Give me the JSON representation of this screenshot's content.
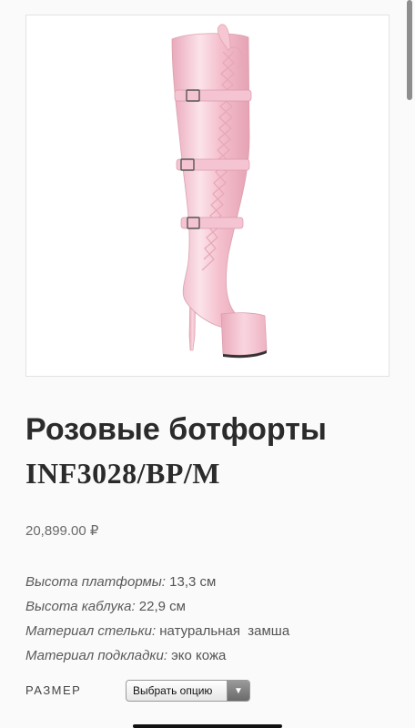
{
  "product": {
    "title": "Розовые ботфорты",
    "sku": "INF3028/BP/M",
    "price": "20,899.00 ₽",
    "specs": [
      {
        "label": "Высота платформы:",
        "value": " 13,3 см"
      },
      {
        "label": "Высота каблука:",
        "value": " 22,9 см"
      },
      {
        "label": "Материал стельки:",
        "value": " натуральная  замша"
      },
      {
        "label": "Материал подкладки:",
        "value": " эко кожа"
      }
    ]
  },
  "size_selector": {
    "label": "РАЗМЕР",
    "placeholder": "Выбрать опцию",
    "arrow_icon": "triangle-down-icon"
  },
  "colors": {
    "boot_pink": "#f3bccb",
    "background": "#fafafa"
  },
  "icons": [
    "product-image",
    "chevron-down-icon"
  ]
}
